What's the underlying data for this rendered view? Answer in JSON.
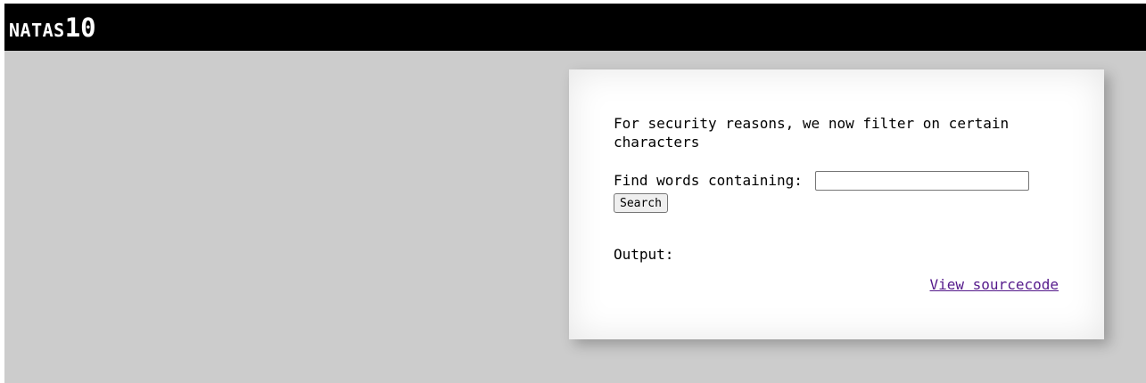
{
  "header": {
    "title_prefix": "NATAS",
    "title_level": "10"
  },
  "main": {
    "intro_text": "For security reasons, we now filter on certain characters",
    "search_label": "Find words containing:",
    "search_value": "",
    "search_placeholder": "",
    "search_button_label": "Search",
    "output_label": "Output:",
    "source_link_text": "View sourcecode"
  },
  "colors": {
    "header_bg": "#000000",
    "page_bg": "#cccccc",
    "content_bg": "#ffffff",
    "link_visited": "#551a8b"
  }
}
